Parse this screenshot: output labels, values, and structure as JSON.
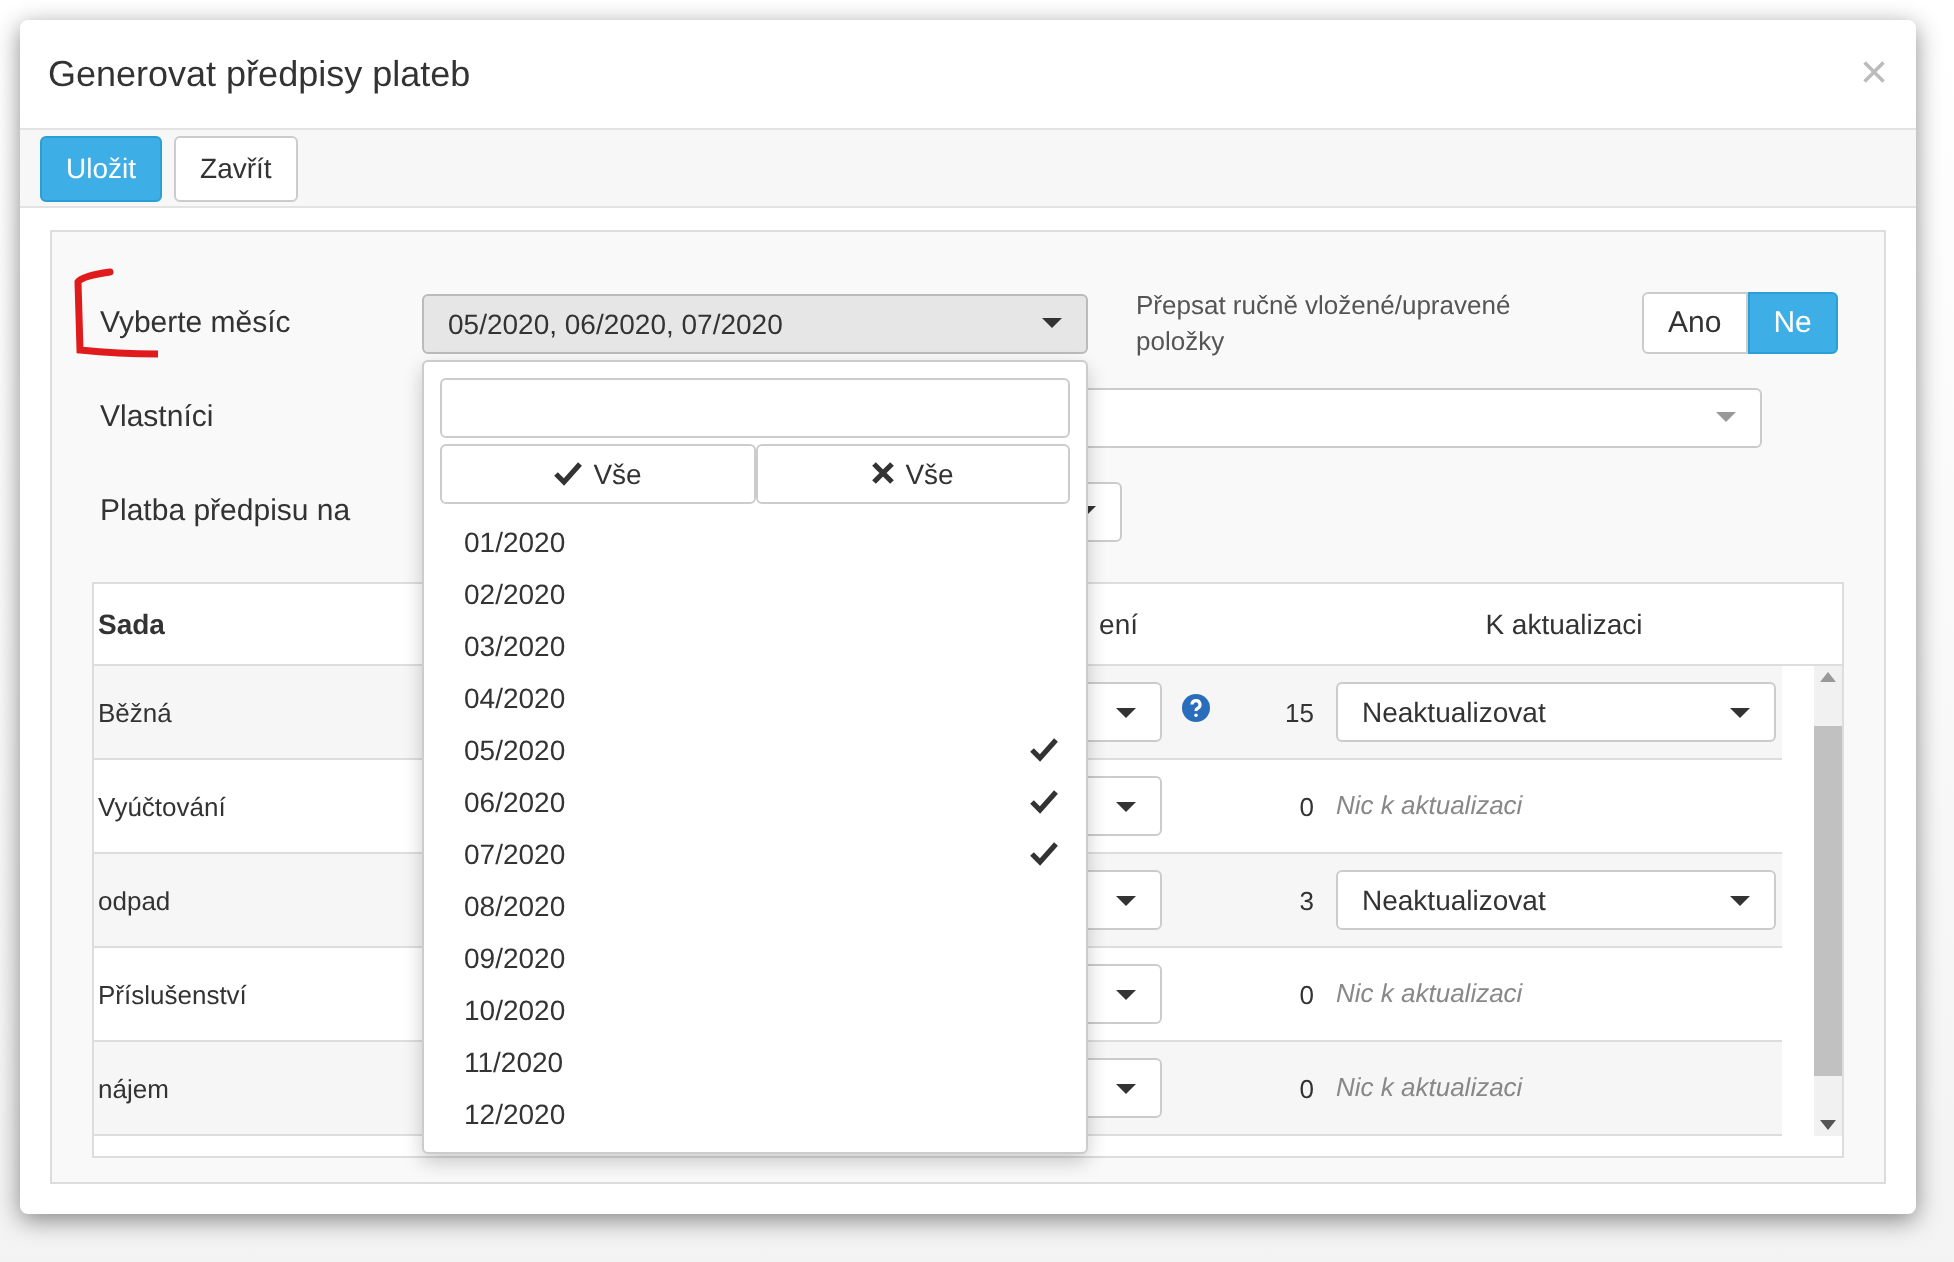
{
  "dialog": {
    "title": "Generovat předpisy plateb",
    "close": "×"
  },
  "toolbar": [
    {
      "label": "Uložit",
      "kind": "primary"
    },
    {
      "label": "Zavřít",
      "kind": "default"
    }
  ],
  "form": {
    "month": {
      "label": "Vyberte měsíc",
      "value": "05/2020, 06/2020, 07/2020",
      "expanded": true
    },
    "overwrite": {
      "label": "Přepsat ručně vložené/upravené položky",
      "options": [
        {
          "label": "Ano",
          "selected": false
        },
        {
          "label": "Ne",
          "selected": true
        }
      ]
    },
    "owners": {
      "label": "Vlastníci"
    },
    "payment": {
      "label": "Platba předpisu na"
    }
  },
  "month_dropdown": {
    "select_all": "Vše",
    "deselect_all": "Vše",
    "items": [
      {
        "label": "01/2020",
        "selected": false
      },
      {
        "label": "02/2020",
        "selected": false
      },
      {
        "label": "03/2020",
        "selected": false
      },
      {
        "label": "04/2020",
        "selected": false
      },
      {
        "label": "05/2020",
        "selected": true
      },
      {
        "label": "06/2020",
        "selected": true
      },
      {
        "label": "07/2020",
        "selected": true
      },
      {
        "label": "08/2020",
        "selected": false
      },
      {
        "label": "09/2020",
        "selected": false
      },
      {
        "label": "10/2020",
        "selected": false
      },
      {
        "label": "11/2020",
        "selected": false
      },
      {
        "label": "12/2020",
        "selected": false
      }
    ]
  },
  "table": {
    "columns": [
      "Sada",
      "ení",
      "K aktualizaci"
    ],
    "rows": [
      {
        "name": "Běžná",
        "help": true,
        "count": "15",
        "update": {
          "kind": "select",
          "text": "Neaktualizovat"
        }
      },
      {
        "name": "Vyúčtování",
        "help": false,
        "count": "0",
        "update": {
          "kind": "note",
          "text": "Nic k aktualizaci"
        }
      },
      {
        "name": "odpad",
        "help": false,
        "count": "3",
        "update": {
          "kind": "select",
          "text": "Neaktualizovat"
        }
      },
      {
        "name": "Příslušenství",
        "help": false,
        "count": "0",
        "update": {
          "kind": "note",
          "text": "Nic k aktualizaci"
        }
      },
      {
        "name": "nájem",
        "help": false,
        "count": "0",
        "update": {
          "kind": "note",
          "text": "Nic k aktualizaci"
        }
      }
    ]
  }
}
